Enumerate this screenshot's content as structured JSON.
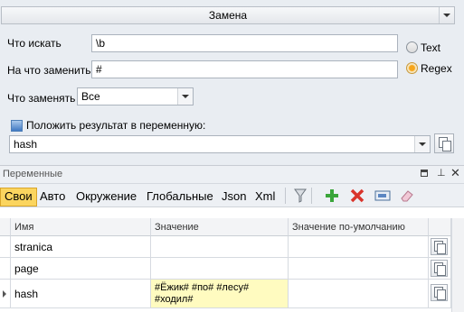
{
  "replace_panel": {
    "mode": "Замена",
    "find_label": "Что искать",
    "find_value": "\\b",
    "replace_label": "На что заменить",
    "replace_value": "#",
    "what_label": "Что заменять",
    "what_value": "Все",
    "radio_text": "Text",
    "radio_regex": "Regex",
    "selected_radio": "Regex",
    "store_checkbox_label": "Положить результат в переменную:",
    "store_checked": true,
    "variable_value": "hash"
  },
  "variables_panel": {
    "title": "Переменные",
    "tabs": [
      "Свои",
      "Авто",
      "Окружение",
      "Глобальные",
      "Json",
      "Xml"
    ],
    "active_tab": "Свои",
    "columns": [
      "Имя",
      "Значение",
      "Значение по-умолчанию"
    ],
    "rows": [
      {
        "name": "stranica",
        "value": "",
        "default": ""
      },
      {
        "name": "page",
        "value": "",
        "default": ""
      },
      {
        "name": "hash",
        "value": "#Ёжик# #по# #лесу# #ходил#",
        "default": ""
      }
    ],
    "selected_row": "hash"
  },
  "colors": {
    "accent": "#fbd55f",
    "panel_bg": "#e9edf2",
    "highlight_cell": "#fffbc0"
  },
  "icons": [
    "dropdown-icon",
    "copy-icon",
    "filter-icon",
    "add-icon",
    "delete-icon",
    "rename-icon",
    "clear-icon",
    "pin-icon",
    "close-icon",
    "panel-menu-icon",
    "row-pointer-icon"
  ]
}
